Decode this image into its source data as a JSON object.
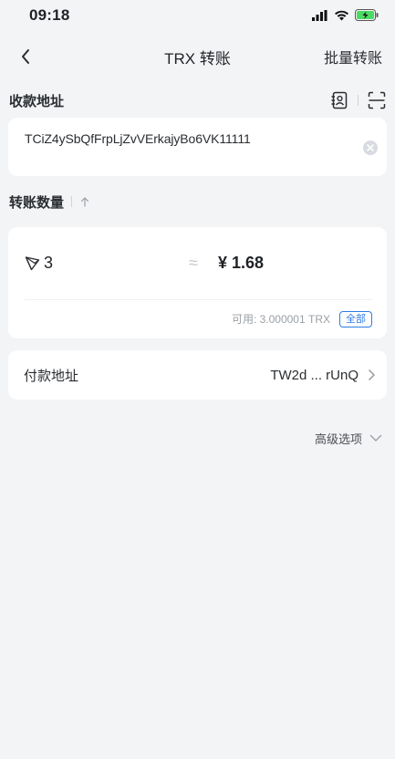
{
  "status_bar": {
    "time": "09:18"
  },
  "header": {
    "title": "TRX 转账",
    "batch_transfer": "批量转账"
  },
  "recipient": {
    "label": "收款地址",
    "address_value": "TCiZ4ySbQfFrpLjZvVErkajyBo6VK11111",
    "icons": [
      "contact-book-icon",
      "scan-icon",
      "clear-icon"
    ]
  },
  "amount": {
    "label": "转账数量",
    "value": "3",
    "token_icon": "tron-icon",
    "approx_symbol": "≈",
    "fiat_value": "¥ 1.68",
    "available": "可用: 3.000001 TRX",
    "all_button": "全部"
  },
  "payer": {
    "label": "付款地址",
    "address_short": "TW2d ... rUnQ"
  },
  "advanced": {
    "label": "高级选项"
  },
  "colors": {
    "background": "#f3f4f6",
    "card": "#ffffff",
    "accent": "#2f7ce6",
    "battery": "#4cd964"
  }
}
